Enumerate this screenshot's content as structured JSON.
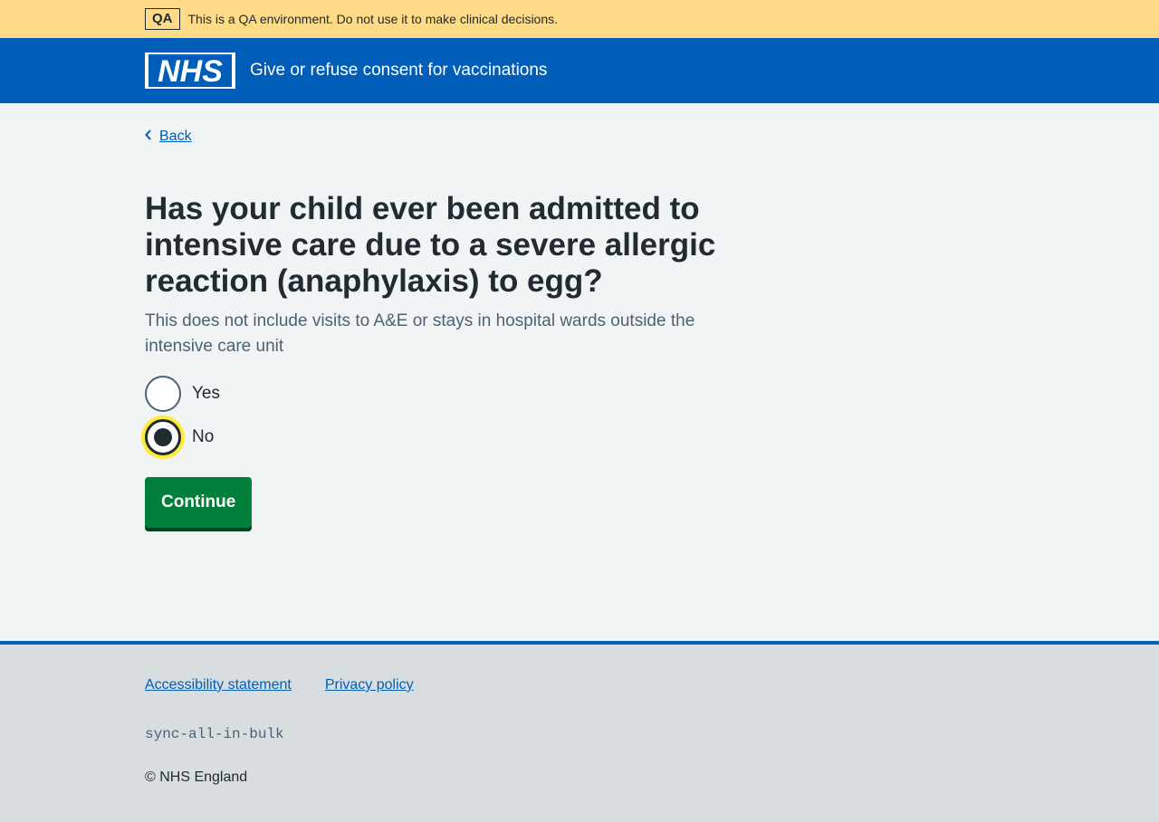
{
  "qa_banner": {
    "tag": "QA",
    "text": "This is a QA environment. Do not use it to make clinical decisions."
  },
  "header": {
    "logo": "NHS",
    "service_name": "Give or refuse consent for vaccinations"
  },
  "main": {
    "back_label": "Back",
    "question": "Has your child ever been admitted to intensive care due to a severe allergic reaction (anaphylaxis) to egg?",
    "hint": "This does not include visits to A&E or stays in hospital wards outside the intensive care unit",
    "options": [
      {
        "label": "Yes",
        "checked": false
      },
      {
        "label": "No",
        "checked": true
      }
    ],
    "continue_label": "Continue"
  },
  "footer": {
    "links": [
      "Accessibility statement",
      "Privacy policy"
    ],
    "build": "sync-all-in-bulk",
    "copyright": "© NHS England"
  },
  "colors": {
    "brand_blue": "#005eb8",
    "qa_yellow": "#ffda87",
    "button_green": "#007f3b",
    "focus_yellow": "#ffeb3b"
  }
}
